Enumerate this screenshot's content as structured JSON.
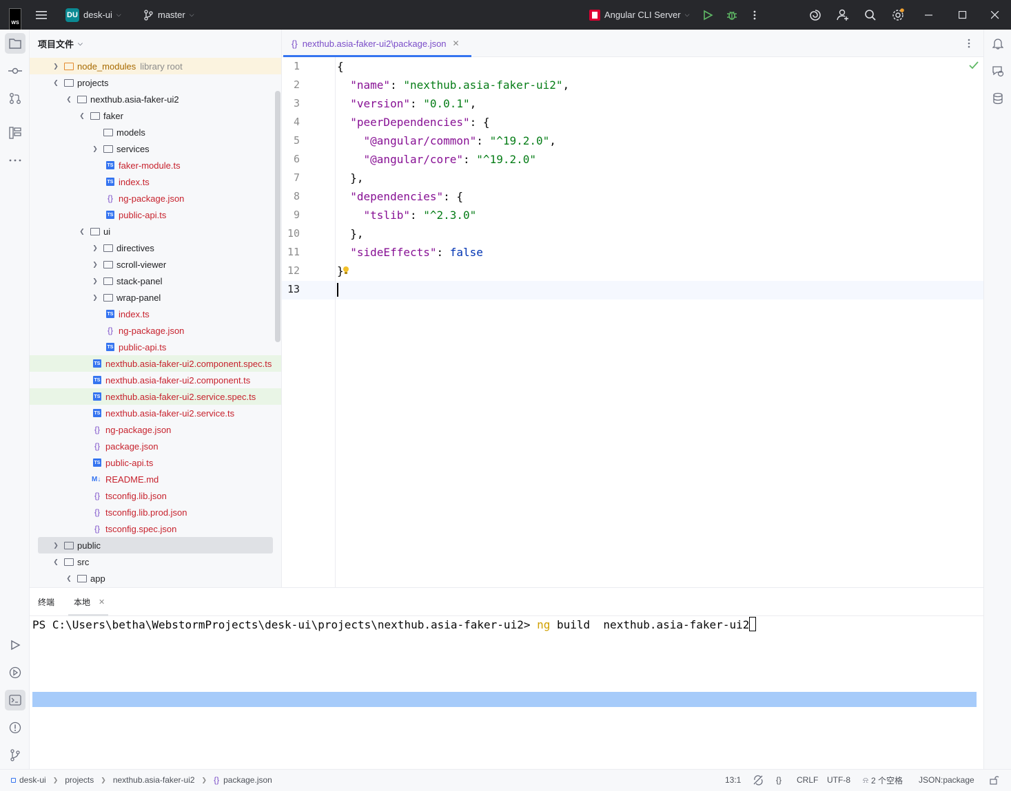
{
  "titlebar": {
    "logo": "WS",
    "project_badge": "DU",
    "project_name": "desk-ui",
    "branch": "master",
    "run_config": "Angular CLI Server"
  },
  "project_panel": {
    "title": "项目文件",
    "rows": [
      {
        "label": "node_modules",
        "suffix": "library root"
      },
      {
        "label": "projects"
      },
      {
        "label": "nexthub.asia-faker-ui2"
      },
      {
        "label": "faker"
      },
      {
        "label": "models"
      },
      {
        "label": "services"
      },
      {
        "label": "faker-module.ts"
      },
      {
        "label": "index.ts"
      },
      {
        "label": "ng-package.json"
      },
      {
        "label": "public-api.ts"
      },
      {
        "label": "ui"
      },
      {
        "label": "directives"
      },
      {
        "label": "scroll-viewer"
      },
      {
        "label": "stack-panel"
      },
      {
        "label": "wrap-panel"
      },
      {
        "label": "index.ts"
      },
      {
        "label": "ng-package.json"
      },
      {
        "label": "public-api.ts"
      },
      {
        "label": "nexthub.asia-faker-ui2.component.spec.ts"
      },
      {
        "label": "nexthub.asia-faker-ui2.component.ts"
      },
      {
        "label": "nexthub.asia-faker-ui2.service.spec.ts"
      },
      {
        "label": "nexthub.asia-faker-ui2.service.ts"
      },
      {
        "label": "ng-package.json"
      },
      {
        "label": "package.json"
      },
      {
        "label": "public-api.ts"
      },
      {
        "label": "README.md"
      },
      {
        "label": "tsconfig.lib.json"
      },
      {
        "label": "tsconfig.lib.prod.json"
      },
      {
        "label": "tsconfig.spec.json"
      },
      {
        "label": "public"
      },
      {
        "label": "src"
      },
      {
        "label": "app"
      }
    ]
  },
  "editor": {
    "tab_label": "nexthub.asia-faker-ui2\\package.json",
    "line_numbers": [
      "1",
      "2",
      "3",
      "4",
      "5",
      "6",
      "7",
      "8",
      "9",
      "10",
      "11",
      "12",
      "13"
    ],
    "lines": [
      {
        "tokens": [
          {
            "t": "{",
            "c": "p"
          }
        ]
      },
      {
        "tokens": [
          {
            "t": "  ",
            "c": "p"
          },
          {
            "t": "\"name\"",
            "c": "k"
          },
          {
            "t": ": ",
            "c": "p"
          },
          {
            "t": "\"nexthub.asia-faker-ui2\"",
            "c": "s"
          },
          {
            "t": ",",
            "c": "p"
          }
        ]
      },
      {
        "tokens": [
          {
            "t": "  ",
            "c": "p"
          },
          {
            "t": "\"version\"",
            "c": "k"
          },
          {
            "t": ": ",
            "c": "p"
          },
          {
            "t": "\"0.0.1\"",
            "c": "s"
          },
          {
            "t": ",",
            "c": "p"
          }
        ]
      },
      {
        "tokens": [
          {
            "t": "  ",
            "c": "p"
          },
          {
            "t": "\"peerDependencies\"",
            "c": "k"
          },
          {
            "t": ": {",
            "c": "p"
          }
        ]
      },
      {
        "tokens": [
          {
            "t": "    ",
            "c": "p"
          },
          {
            "t": "\"@angular/common\"",
            "c": "k"
          },
          {
            "t": ": ",
            "c": "p"
          },
          {
            "t": "\"^19.2.0\"",
            "c": "s"
          },
          {
            "t": ",",
            "c": "p"
          }
        ]
      },
      {
        "tokens": [
          {
            "t": "    ",
            "c": "p"
          },
          {
            "t": "\"@angular/core\"",
            "c": "k"
          },
          {
            "t": ": ",
            "c": "p"
          },
          {
            "t": "\"^19.2.0\"",
            "c": "s"
          }
        ]
      },
      {
        "tokens": [
          {
            "t": "  },",
            "c": "p"
          }
        ]
      },
      {
        "tokens": [
          {
            "t": "  ",
            "c": "p"
          },
          {
            "t": "\"dependencies\"",
            "c": "k"
          },
          {
            "t": ": {",
            "c": "p"
          }
        ]
      },
      {
        "tokens": [
          {
            "t": "    ",
            "c": "p"
          },
          {
            "t": "\"tslib\"",
            "c": "k"
          },
          {
            "t": ": ",
            "c": "p"
          },
          {
            "t": "\"^2.3.0\"",
            "c": "s"
          }
        ]
      },
      {
        "tokens": [
          {
            "t": "  },",
            "c": "p"
          }
        ]
      },
      {
        "tokens": [
          {
            "t": "  ",
            "c": "p"
          },
          {
            "t": "\"sideEffects\"",
            "c": "k"
          },
          {
            "t": ": ",
            "c": "p"
          },
          {
            "t": "false",
            "c": "b"
          }
        ]
      },
      {
        "tokens": [
          {
            "t": "}",
            "c": "p"
          }
        ]
      },
      {
        "tokens": [
          {
            "t": "",
            "c": "p"
          }
        ]
      }
    ]
  },
  "terminal": {
    "tab_title": "终端",
    "tab_local": "本地",
    "prompt": "PS C:\\Users\\betha\\WebstormProjects\\desk-ui\\projects\\nexthub.asia-faker-ui2> ",
    "cmd_ng": "ng",
    "cmd_rest": " build  nexthub.asia-faker-ui2"
  },
  "statusbar": {
    "crumbs": [
      "desk-ui",
      "projects",
      "nexthub.asia-faker-ui2",
      "package.json"
    ],
    "position": "13:1",
    "line_sep": "CRLF",
    "encoding": "UTF-8",
    "indent": "2 个空格",
    "file_type": "JSON:package"
  },
  "colors": {
    "accent": "#3574f0",
    "titlebar_bg": "#27282c",
    "json_key": "#871094",
    "json_string": "#067d17",
    "json_keyword": "#0033b3"
  }
}
